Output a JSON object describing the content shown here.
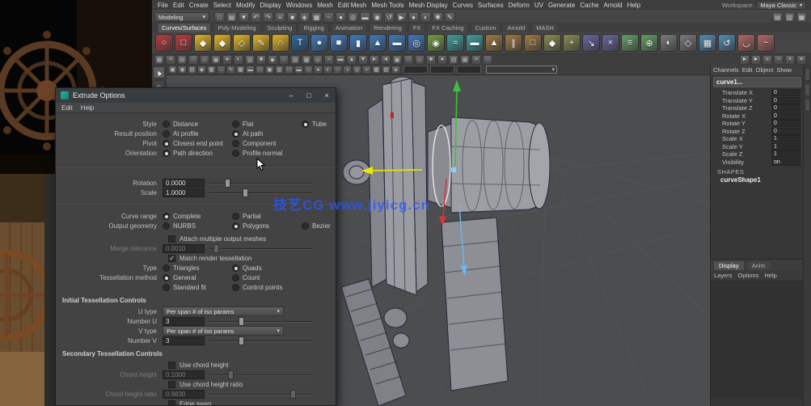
{
  "menu_bar": {
    "items": [
      "File",
      "Edit",
      "Create",
      "Select",
      "Modify",
      "Display",
      "Windows",
      "Mesh",
      "Edit Mesh",
      "Mesh Tools",
      "Mesh Display",
      "Curves",
      "Surfaces",
      "Deform",
      "UV",
      "Generate",
      "Cache",
      "Arnold",
      "Help"
    ]
  },
  "workspace": {
    "label": "Workspace:",
    "value": "Maya Classic"
  },
  "status_line": {
    "menu_set": "Modeling",
    "icons": [
      {
        "name": "new-scene-icon",
        "glyph": "□"
      },
      {
        "name": "open-scene-icon",
        "glyph": "▤"
      },
      {
        "name": "save-scene-icon",
        "glyph": "▼"
      },
      {
        "name": "undo-icon",
        "glyph": "↶"
      },
      {
        "name": "redo-icon",
        "glyph": "↷"
      },
      {
        "name": "select-by-hierarchy-icon",
        "glyph": "≡"
      },
      {
        "name": "select-by-object-icon",
        "glyph": "■"
      },
      {
        "name": "select-by-component-icon",
        "glyph": "◈"
      },
      {
        "name": "snap-to-grid-icon",
        "glyph": "▦"
      },
      {
        "name": "snap-to-curve-icon",
        "glyph": "~"
      },
      {
        "name": "snap-to-point-icon",
        "glyph": "●"
      },
      {
        "name": "snap-to-projected-center-icon",
        "glyph": "◎"
      },
      {
        "name": "snap-to-view-plane-icon",
        "glyph": "▬"
      },
      {
        "name": "make-live-icon",
        "glyph": "◉"
      },
      {
        "name": "construction-history-icon",
        "glyph": "↺"
      },
      {
        "name": "open-render-view-icon",
        "glyph": "▶"
      },
      {
        "name": "render-current-frame-icon",
        "glyph": "●"
      },
      {
        "name": "ipr-render-icon",
        "glyph": "◐"
      },
      {
        "name": "render-settings-icon",
        "glyph": "✱"
      },
      {
        "name": "paint-effects-icon",
        "glyph": "✎"
      }
    ],
    "right_icons": [
      {
        "name": "show-attribute-editor-icon",
        "glyph": "▤"
      },
      {
        "name": "show-tool-settings-icon",
        "glyph": "▥"
      },
      {
        "name": "show-channel-box-icon",
        "glyph": "▦"
      }
    ]
  },
  "shelf": {
    "tabs": [
      {
        "label": "Curves/Surfaces",
        "active": true
      },
      {
        "label": "Poly Modeling"
      },
      {
        "label": "Sculpting"
      },
      {
        "label": "Rigging"
      },
      {
        "label": "Animation"
      },
      {
        "label": "Rendering"
      },
      {
        "label": "FX"
      },
      {
        "label": "FX Caching"
      },
      {
        "label": "Custom"
      },
      {
        "label": "Arnold"
      },
      {
        "label": "MASH"
      }
    ],
    "icons": [
      {
        "name": "nurbs-circle-icon",
        "color": "#a63b3b",
        "glyph": "○"
      },
      {
        "name": "nurbs-square-icon",
        "color": "#a63b3b",
        "glyph": "□"
      },
      {
        "name": "cv-curve-tool-icon",
        "color": "#c9a227",
        "glyph": "◆"
      },
      {
        "name": "ep-curve-tool-icon",
        "color": "#c9a227",
        "glyph": "◆"
      },
      {
        "name": "bezier-curve-tool-icon",
        "color": "#c9a227",
        "glyph": "◇"
      },
      {
        "name": "pencil-curve-tool-icon",
        "color": "#c9a227",
        "glyph": "✎"
      },
      {
        "name": "arc-tool-icon",
        "color": "#c9a227",
        "glyph": "∩"
      },
      {
        "name": "text-tool-icon",
        "color": "#2f5f8f",
        "glyph": "T"
      },
      {
        "name": "nurbs-sphere-icon",
        "color": "#3f6fa8",
        "glyph": "●"
      },
      {
        "name": "nurbs-cube-icon",
        "color": "#3f6fa8",
        "glyph": "■"
      },
      {
        "name": "nurbs-cylinder-icon",
        "color": "#3f6fa8",
        "glyph": "▮"
      },
      {
        "name": "nurbs-cone-icon",
        "color": "#3f6fa8",
        "glyph": "▲"
      },
      {
        "name": "nurbs-plane-icon",
        "color": "#3f6fa8",
        "glyph": "▬"
      },
      {
        "name": "nurbs-torus-icon",
        "color": "#3f6fa8",
        "glyph": "◎"
      },
      {
        "name": "revolve-icon",
        "color": "#6a8f3f",
        "glyph": "◉"
      },
      {
        "name": "loft-icon",
        "color": "#3f8f8f",
        "glyph": "≈"
      },
      {
        "name": "planar-icon",
        "color": "#3f8f8f",
        "glyph": "▬"
      },
      {
        "name": "extrude-icon",
        "color": "#8f6f3f",
        "glyph": "▲"
      },
      {
        "name": "birail-icon",
        "color": "#8f6f3f",
        "glyph": "∥"
      },
      {
        "name": "boundary-icon",
        "color": "#8f6f3f",
        "glyph": "□"
      },
      {
        "name": "bevel-icon",
        "color": "#7f7f4f",
        "glyph": "◆"
      },
      {
        "name": "bevel-plus-icon",
        "color": "#7f7f4f",
        "glyph": "+"
      },
      {
        "name": "project-curve-icon",
        "color": "#5f5f8f",
        "glyph": "↘"
      },
      {
        "name": "trim-tool-icon",
        "color": "#5f5f8f",
        "glyph": "×"
      },
      {
        "name": "insert-isoparm-icon",
        "color": "#5f8f5f",
        "glyph": "≡"
      },
      {
        "name": "attach-surfaces-icon",
        "color": "#5f8f5f",
        "glyph": "⊕"
      },
      {
        "name": "intersect-surfaces-icon",
        "color": "#707070",
        "glyph": "◐"
      },
      {
        "name": "untrim-icon",
        "color": "#707070",
        "glyph": "◇"
      },
      {
        "name": "rebuild-surface-icon",
        "color": "#4f7f9f",
        "glyph": "▦"
      },
      {
        "name": "reverse-direction-icon",
        "color": "#4f7f9f",
        "glyph": "↺"
      },
      {
        "name": "surface-fillet-icon",
        "color": "#9f5f5f",
        "glyph": "◡"
      },
      {
        "name": "freeform-fillet-icon",
        "color": "#9f5f5f",
        "glyph": "~"
      }
    ]
  },
  "toolbar2": {
    "icons": [
      "▦",
      "≡",
      "▤",
      "□",
      "◇",
      "▣",
      "●",
      "◐",
      "▥",
      "■",
      "◆",
      "○",
      "▧",
      "▩",
      "◎",
      "≈",
      "▬",
      "▲",
      "▼",
      "►",
      "◄",
      "▣",
      "□",
      "◇",
      "■",
      "●",
      "▤",
      "▦",
      "≡",
      "○"
    ]
  },
  "channel_bar": {
    "icons": [
      {
        "name": "channel-speed-slow-icon",
        "glyph": "►"
      },
      {
        "name": "channel-speed-medium-icon",
        "glyph": "►"
      },
      {
        "name": "channel-speed-fast-icon",
        "glyph": "»"
      },
      {
        "name": "hyperbolic-manip-icon",
        "glyph": "~"
      },
      {
        "name": "no-manips-icon",
        "glyph": "×"
      },
      {
        "name": "channel-settings-icon",
        "glyph": "≡"
      }
    ]
  },
  "viewport": {
    "toolbar_icons": [
      {
        "name": "select-camera-icon",
        "glyph": "▣"
      },
      {
        "name": "lock-camera-icon",
        "glyph": "◉"
      },
      {
        "name": "camera-attributes-icon",
        "glyph": "▤"
      },
      {
        "name": "bookmarks-icon",
        "glyph": "◆"
      },
      {
        "name": "image-plane-icon",
        "glyph": "▦"
      },
      {
        "name": "2d-pan-zoom-icon",
        "glyph": "↔"
      },
      {
        "name": "grease-pencil-icon",
        "glyph": "✎"
      },
      {
        "name": "grid-icon",
        "glyph": "▦"
      },
      {
        "name": "film-gate-icon",
        "glyph": "▬"
      },
      {
        "name": "resolution-gate-icon",
        "glyph": "□"
      },
      {
        "name": "gate-mask-icon",
        "glyph": "▣"
      },
      {
        "name": "field-chart-icon",
        "glyph": "▥"
      },
      {
        "name": "safe-action-icon",
        "glyph": "□"
      },
      {
        "name": "safe-title-icon",
        "glyph": "▬"
      },
      {
        "name": "wireframe-icon",
        "glyph": "◇"
      },
      {
        "name": "shaded-icon",
        "glyph": "●"
      },
      {
        "name": "textured-icon",
        "glyph": "◐"
      },
      {
        "name": "use-all-lights-icon",
        "glyph": "○"
      },
      {
        "name": "shadows-icon",
        "glyph": "◑"
      },
      {
        "name": "screen-space-ao-icon",
        "glyph": "◎"
      },
      {
        "name": "motion-blur-icon",
        "glyph": "≈"
      },
      {
        "name": "multisample-icon",
        "glyph": "▩"
      },
      {
        "name": "xray-icon",
        "glyph": "▧"
      },
      {
        "name": "isolate-select-icon",
        "glyph": "◈"
      }
    ]
  },
  "toolbox": {
    "tools": [
      {
        "name": "select-tool-icon",
        "glyph": "▲"
      },
      {
        "name": "lasso-tool-icon",
        "glyph": "○"
      },
      {
        "name": "paint-select-tool-icon",
        "glyph": "✎"
      },
      {
        "name": "move-tool-icon",
        "glyph": "+"
      },
      {
        "name": "rotate-tool-icon",
        "glyph": "↻"
      },
      {
        "name": "scale-tool-icon",
        "glyph": "▣"
      }
    ],
    "layouts": [
      {
        "name": "single-pane-layout-icon",
        "glyph": "□"
      },
      {
        "name": "four-pane-layout-icon",
        "glyph": "▦"
      },
      {
        "name": "persp-outliner-layout-icon",
        "glyph": "▥"
      },
      {
        "name": "hypershade-persp-layout-icon",
        "glyph": "▤"
      }
    ]
  },
  "channel_box": {
    "menus": [
      "Channels",
      "Edit",
      "Object",
      "Show"
    ],
    "node_name": "curve1...",
    "attributes": [
      [
        "Translate X",
        "0"
      ],
      [
        "Translate Y",
        "0"
      ],
      [
        "Translate Z",
        "0"
      ],
      [
        "Rotate X",
        "0"
      ],
      [
        "Rotate Y",
        "0"
      ],
      [
        "Rotate Z",
        "0"
      ],
      [
        "Scale X",
        "1"
      ],
      [
        "Scale Y",
        "1"
      ],
      [
        "Scale Z",
        "1"
      ],
      [
        "Visibility",
        "on"
      ]
    ],
    "shapes_header": "SHAPES",
    "shape_name": "curveShape1"
  },
  "layer_editor": {
    "tabs": [
      {
        "label": "Display",
        "active": true
      },
      {
        "label": "Anim"
      }
    ],
    "menus": [
      "Layers",
      "Options",
      "Help"
    ]
  },
  "dialog": {
    "title": "Extrude Options",
    "menus": [
      "Edit",
      "Help"
    ],
    "window_buttons": [
      {
        "name": "minimize-button",
        "glyph": "–"
      },
      {
        "name": "maximize-button",
        "glyph": "□"
      },
      {
        "name": "close-button",
        "glyph": "×"
      }
    ],
    "style": {
      "label": "Style",
      "options": [
        "Distance",
        "Flat",
        "Tube"
      ],
      "selected_index": 2
    },
    "result_position": {
      "label": "Result position",
      "options": [
        "At profile",
        "At path"
      ],
      "selected_index": 1
    },
    "pivot": {
      "label": "Pivot",
      "options": [
        "Closest end point",
        "Component"
      ],
      "selected_index": 0
    },
    "orientation": {
      "label": "Orientation",
      "options": [
        "Path direction",
        "Profile normal"
      ],
      "selected_index": 0
    },
    "rotation": {
      "label": "Rotation",
      "value": "0.0000"
    },
    "scale": {
      "label": "Scale",
      "value": "1.0000"
    },
    "curve_range": {
      "label": "Curve range",
      "options": [
        "Complete",
        "Partial"
      ],
      "selected_index": 0
    },
    "output_geometry": {
      "label": "Output geometry",
      "options": [
        "NURBS",
        "Polygons",
        "Bezier"
      ],
      "selected_index": 1
    },
    "attach_multiple": {
      "label": "Attach multiple output meshes",
      "checked": false
    },
    "merge_tolerance": {
      "label": "Merge tolerance",
      "value": "0.0010"
    },
    "match_render": {
      "label": "Match render tessellation",
      "checked": true
    },
    "type": {
      "label": "Type",
      "options": [
        "Triangles",
        "Quads"
      ],
      "selected_index": 1
    },
    "tess_method": {
      "label": "Tessellation method",
      "options": [
        "General",
        "Count"
      ],
      "selected_index": 0
    },
    "tess_method2": {
      "label": "",
      "options": [
        "Standard fit",
        "Control points"
      ],
      "selected_index": -1
    },
    "initial_header": "Initial Tessellation Controls",
    "u_type": {
      "label": "U type",
      "value": "Per span # of iso params"
    },
    "number_u": {
      "label": "Number U",
      "value": "3"
    },
    "v_type": {
      "label": "V type",
      "value": "Per span # of iso params"
    },
    "number_v": {
      "label": "Number V",
      "value": "3"
    },
    "secondary_header": "Secondary Tessellation Controls",
    "use_chord_height": {
      "label": "Use chord height",
      "checked": false
    },
    "chord_height": {
      "label": "Chord height",
      "value": "0.1000"
    },
    "use_chord_height_ratio": {
      "label": "Use chord height ratio",
      "checked": false
    },
    "chord_height_ratio": {
      "label": "Chord height ratio",
      "value": "0.9830"
    },
    "edge_swap": {
      "label": "Edge swap",
      "checked": false
    }
  },
  "watermark": {
    "text": "技艺CG www.jiyicg.cn",
    "color": "#2857ff"
  },
  "colors": {
    "manipulator_x": "#e8e800",
    "manipulator_y": "#3fbf3f",
    "manipulator_z": "#66bbee",
    "selected_edge": "#ececec",
    "viewport_bg": "#4c4d4f"
  }
}
